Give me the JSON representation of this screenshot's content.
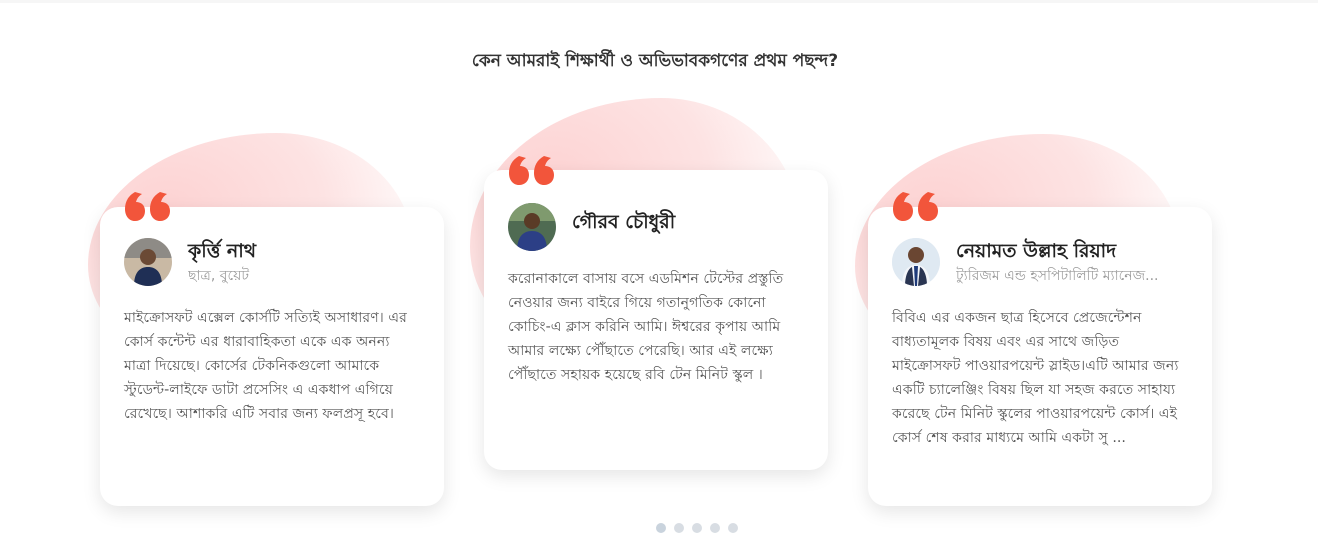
{
  "section": {
    "title": "কেন আমরাই শিক্ষার্থী ও অভিভাবকগণের প্রথম পছন্দ?"
  },
  "testimonials": [
    {
      "name": "কৃর্ত্তি নাথ",
      "role": "ছাত্র, বুয়েট",
      "text": "মাইক্রোসফট এক্সেল কোর্সটি সত্যিই অসাধারণ। এর কোর্স কন্টেন্ট এর ধারাবাহিকতা একে এক অনন্য মাত্রা দিয়েছে। কোর্সের টেকনিকগুলো আমাকে স্টুডেন্ট-লাইফে ডাটা প্রসেসিং এ একধাপ এগিয়ে রেখেছে। আশাকরি এটি সবার জন্য ফলপ্রসূ হবে।",
      "avatar_icon": "student-avatar"
    },
    {
      "name": "গৌরব চৌধুরী",
      "role": "",
      "text": "করোনাকালে বাসায় বসে এডমিশন টেস্টের প্রস্তুতি নেওয়ার জন্য বাইরে গিয়ে গতানুগতিক কোনো কোচিং-এ ক্লাস করিনি আমি। ঈশ্বরের কৃপায় আমি আমার লক্ষ্যে পৌঁছাতে পেরেছি। আর এই লক্ষ্যে পৌঁছাতে সহায়ক হয়েছে রবি টেন মিনিট স্কুল ।",
      "avatar_icon": "student-avatar"
    },
    {
      "name": "নেয়ামত উল্লাহ রিয়াদ",
      "role": "ট্যুরিজম এন্ড হসপিটালিটি ম্যানেজ...",
      "text": "বিবিএ এর একজন ছাত্র হিসেবে প্রেজেন্টেশন বাধ্যতামূলক বিষয় এবং এর সাথে জড়িত মাইক্রোসফট পাওয়ারপয়েন্ট স্লাইড।এটি আমার জন্য একটি চ্যালেঞ্জিং বিষয় ছিল যা সহজ করতে সাহায্য করেছে টেন মিনিট স্কুলের পাওয়ারপয়েন্ট কোর্স। এই কোর্স শেষ করার মাধ্যমে আমি একটা সু ...",
      "avatar_icon": "student-avatar"
    }
  ],
  "colors": {
    "accent": "#f2553b",
    "blob": "#fdd8d8",
    "card_bg": "#ffffff"
  },
  "icons": {
    "quote": "quote-mark-icon"
  }
}
